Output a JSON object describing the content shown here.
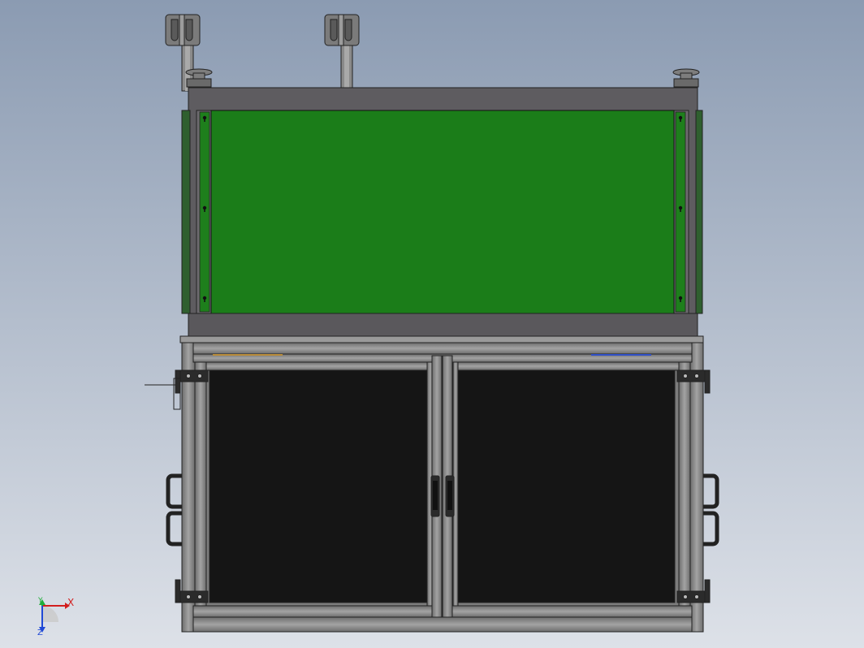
{
  "viewport": {
    "background_top": "#8b9bb2",
    "background_bottom": "#dde1e8"
  },
  "model": {
    "panel_color": "#1b7d19",
    "frame_color": "#5e5c60",
    "door_glass_color": "#151515",
    "extrusion_color": "#8a8a8a",
    "outline_color": "#222222"
  },
  "triad": {
    "x_label": "X",
    "y_label": "Y",
    "z_label": "Z",
    "x_color": "#d21e1e",
    "y_color": "#1fae3a",
    "z_color": "#2049d6"
  }
}
